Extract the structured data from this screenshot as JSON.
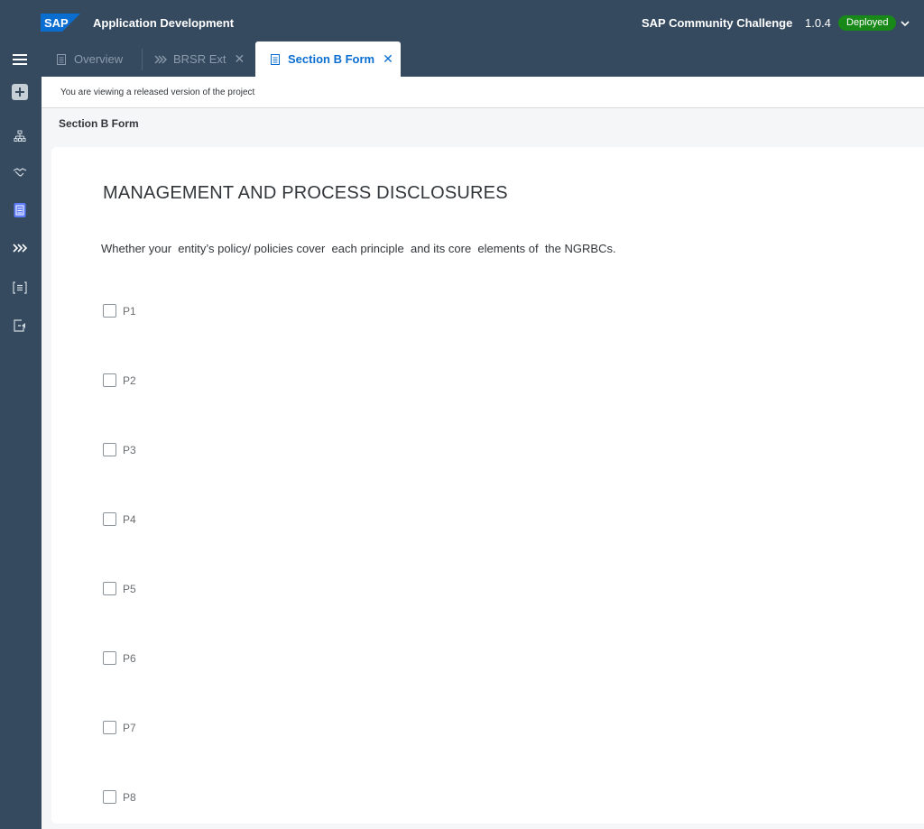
{
  "shell": {
    "logo_text": "SAP",
    "app_title": "Application Development",
    "project_name": "SAP Community Challenge",
    "version": "1.0.4",
    "status": "Deployed",
    "colors": {
      "frame": "#354a5f",
      "status": "#188918",
      "accent": "#0a6ed1",
      "logo": "#0a6ed1"
    }
  },
  "tabs": [
    {
      "label": "Overview",
      "icon": "document-icon",
      "closable": false,
      "active": false
    },
    {
      "label": "BRSR Ext",
      "icon": "chevrons-icon",
      "closable": true,
      "active": false
    },
    {
      "label": "Section B Form",
      "icon": "form-icon",
      "closable": true,
      "active": true
    }
  ],
  "side_nav": [
    "menu-icon",
    "add-icon",
    "hierarchy-icon",
    "handshake-icon",
    "form-icon",
    "chevrons-icon",
    "list-icon",
    "export-icon"
  ],
  "info_message": "You are viewing a released version of the project",
  "page_title": "Section B Form",
  "form": {
    "heading": "MANAGEMENT AND PROCESS DISCLOSURES",
    "question": "Whether your  entity’s policy/ policies cover  each principle  and its core  elements of  the NGRBCs.",
    "options": [
      {
        "label": "P1",
        "checked": false
      },
      {
        "label": "P2",
        "checked": false
      },
      {
        "label": "P3",
        "checked": false
      },
      {
        "label": "P4",
        "checked": false
      },
      {
        "label": "P5",
        "checked": false
      },
      {
        "label": "P6",
        "checked": false
      },
      {
        "label": "P7",
        "checked": false
      },
      {
        "label": "P8",
        "checked": false
      }
    ]
  }
}
